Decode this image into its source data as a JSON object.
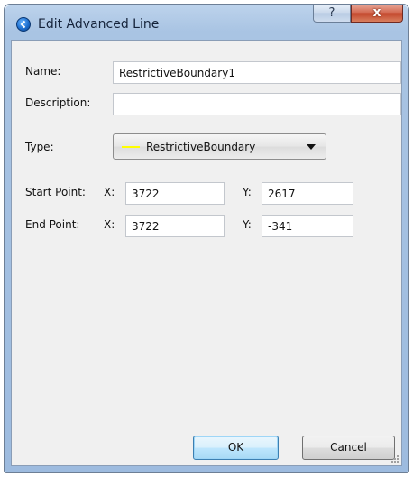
{
  "window": {
    "title": "Edit Advanced Line",
    "help_label": "?",
    "close_label": "x"
  },
  "form": {
    "name_label": "Name:",
    "name_value": "RestrictiveBoundary1",
    "description_label": "Description:",
    "description_value": "",
    "type_label": "Type:",
    "type_value": "RestrictiveBoundary",
    "type_swatch_color": "#ffff00",
    "start_label": "Start Point:",
    "start_x_label": "X:",
    "start_x_value": "3722",
    "start_y_label": "Y:",
    "start_y_value": "2617",
    "end_label": "End Point:",
    "end_x_label": "X:",
    "end_x_value": "3722",
    "end_y_label": "Y:",
    "end_y_value": "-341"
  },
  "buttons": {
    "ok_label": "OK",
    "cancel_label": "Cancel"
  }
}
